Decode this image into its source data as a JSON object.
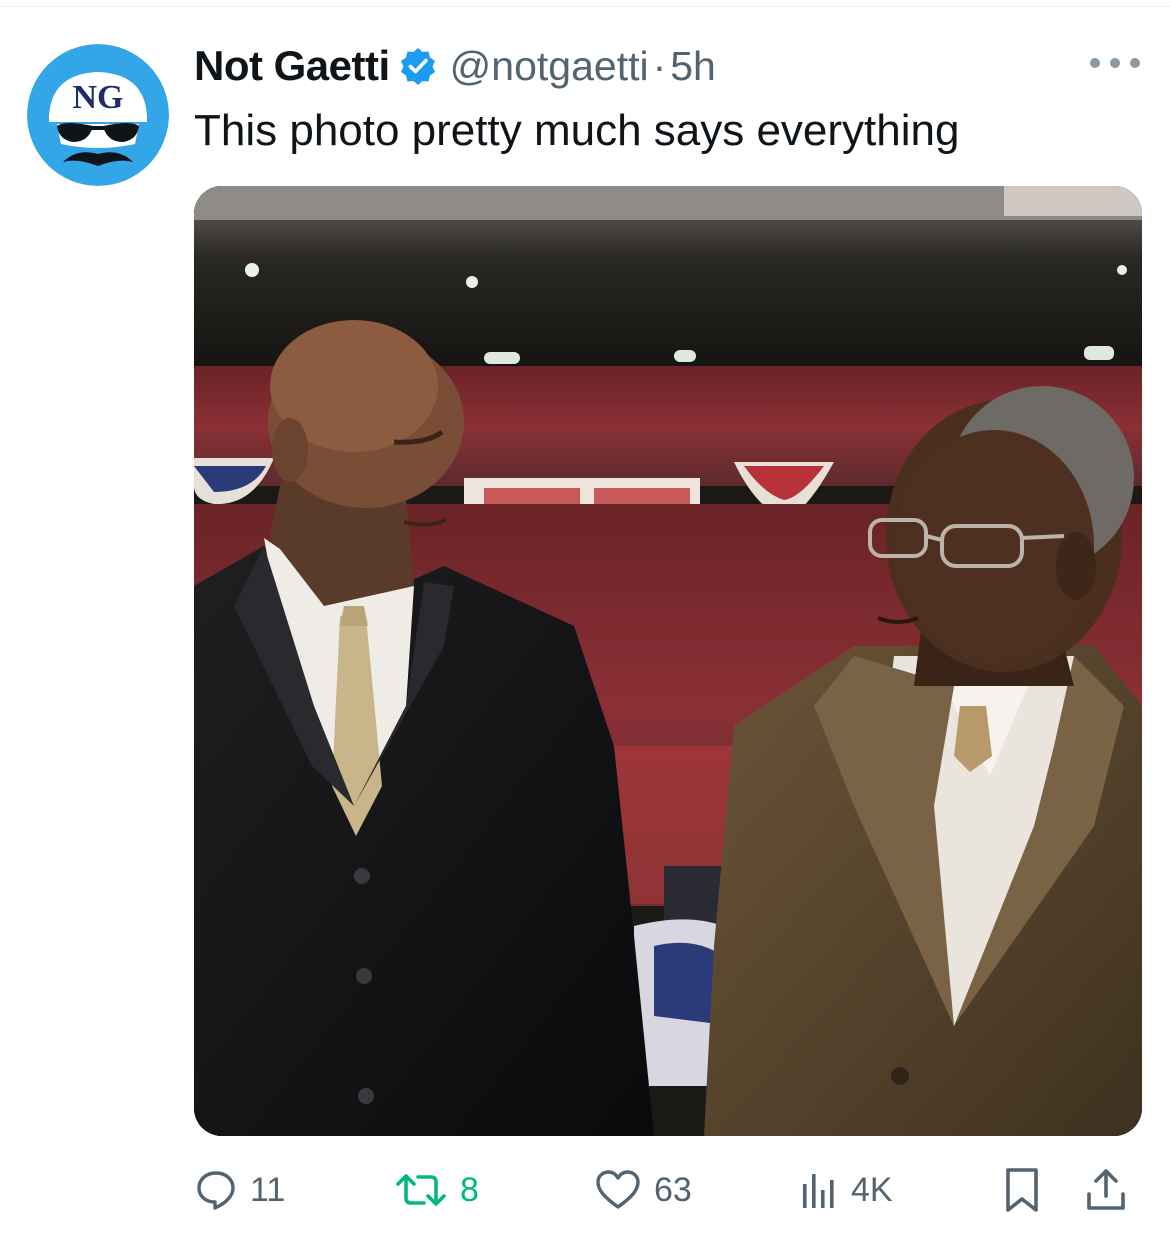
{
  "tweet": {
    "author": {
      "display_name": "Not Gaetti",
      "handle": "@notgaetti",
      "verified": true,
      "avatar_initials": "NG"
    },
    "separator": "·",
    "timestamp": "5h",
    "text": "This photo pretty much says everything",
    "media": {
      "type": "photo"
    },
    "actions": {
      "replies": "11",
      "retweets": "8",
      "likes": "63",
      "views": "4K"
    }
  },
  "icons": {
    "reply": "speech-bubble",
    "retweet": "retweet-arrows",
    "like": "heart-outline",
    "views": "bar-chart",
    "bookmark": "bookmark-outline",
    "share": "share-upload",
    "more": "three-dots",
    "verified": "blue-check-badge"
  },
  "colors": {
    "accent_blue": "#1d9bf0",
    "retweeted_green": "#00ba7c",
    "text_primary": "#0f1419",
    "text_secondary": "#536471"
  }
}
